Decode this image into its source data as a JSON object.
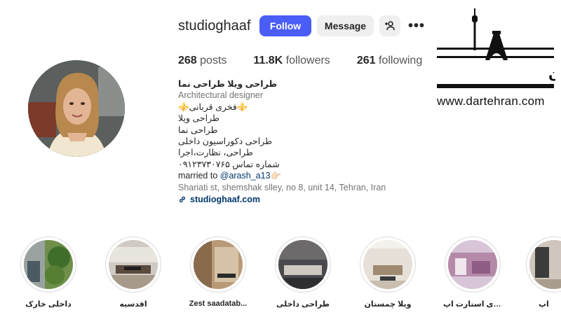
{
  "profile": {
    "username": "studioghaaf",
    "follow_label": "Follow",
    "message_label": "Message",
    "suggest_icon": "add-person-icon",
    "more_icon": "more-icon",
    "more_glyph": "•••"
  },
  "stats": {
    "posts_count": "268",
    "posts_label": "posts",
    "followers_count": "11.8K",
    "followers_label": "followers",
    "following_count": "261",
    "following_label": "following"
  },
  "bio": {
    "name": "طراحی ویلا طراحی نما",
    "category": "Architectural designer",
    "lines": [
      "⚜️فخری قربانی⚜️",
      "طراحی ویلا",
      "طراحی نما",
      "طراحی دکوراسیون داخلی",
      "طراحی، نظارت،اجرا",
      "شماره تماس ۰۹۱۲۳۷۳۰۷۶۵"
    ],
    "married_prefix": "married to ",
    "married_mention": "@arash_a13",
    "married_emoji": "👉🏻",
    "address": "Shariati st, shemshak slley, no 8, unit 14, Tehran, Iran",
    "website": "studioghaaf.com"
  },
  "watermark": {
    "brand": "در تهـران",
    "site": "www.dartehran.com"
  },
  "highlights": [
    {
      "label": "داخلی خارک"
    },
    {
      "label": "اقدسیه"
    },
    {
      "label": "Zest saadatab..."
    },
    {
      "label": "طراحی داخلی"
    },
    {
      "label": "ویلا چمستان"
    },
    {
      "label": "اجرای استارت اپ"
    },
    {
      "label": "اپ"
    }
  ],
  "colors": {
    "follow_button": "#4a5df5",
    "secondary_button": "#efefef",
    "link": "#00376b",
    "muted": "#737373"
  }
}
